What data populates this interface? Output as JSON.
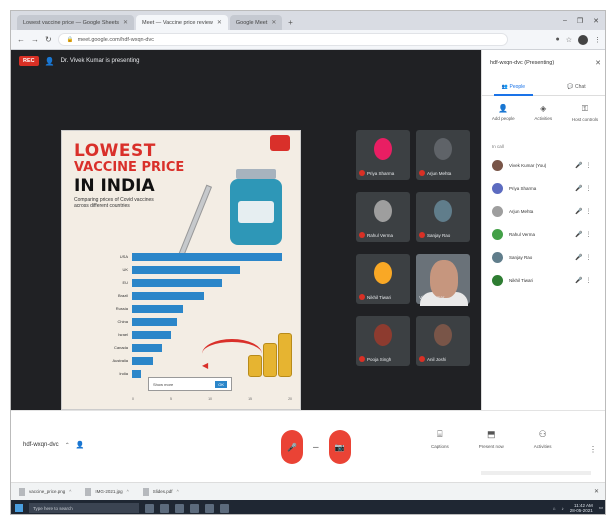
{
  "browser": {
    "tabs": [
      {
        "label": "Lowest vaccine price — Google Sheets",
        "active": false
      },
      {
        "label": "Meet — Vaccine price review",
        "active": true
      },
      {
        "label": "Google Meet",
        "active": false
      }
    ],
    "url": "meet.google.com/hdf-wxqn-dvc",
    "new_tab": "+",
    "window_controls": [
      "–",
      "❐",
      "✕"
    ]
  },
  "meet": {
    "recording_badge": "REC",
    "presenting_text": "Dr. Vivek Kumar is presenting",
    "slide": {
      "title_line1": "LOWEST",
      "title_line2": "VACCINE PRICE",
      "title_line3": "IN INDIA",
      "subtitle": "Comparing prices of Covid vaccines across different countries",
      "popup_text": "Show more",
      "popup_button": "OK"
    },
    "chart_data": {
      "type": "bar",
      "orientation": "horizontal",
      "categories": [
        "USA",
        "UK",
        "EU",
        "Brazil",
        "Russia",
        "China",
        "Israel",
        "Canada",
        "Australia",
        "India"
      ],
      "values": [
        100,
        72,
        60,
        48,
        34,
        30,
        26,
        20,
        14,
        6
      ],
      "axis_ticks": [
        "0",
        "5",
        "10",
        "15",
        "20"
      ],
      "xlim": [
        0,
        100
      ],
      "colors": {
        "bars": "#2b86c9"
      }
    },
    "participants": [
      {
        "name": "Priya Sharma",
        "avatar_color": "#e91e63",
        "muted": true,
        "video": false
      },
      {
        "name": "Arjun Mehta",
        "avatar_color": "#5f6368",
        "muted": true,
        "video": false
      },
      {
        "name": "Rahul Verma",
        "avatar_color": "#9e9e9e",
        "muted": true,
        "video": false
      },
      {
        "name": "Sanjay Rao",
        "avatar_color": "#607d8b",
        "muted": true,
        "video": false
      },
      {
        "name": "Nikhil Tiwari",
        "avatar_color": "#f9a825",
        "muted": true,
        "video": false
      },
      {
        "name": "Vivek Kumar",
        "avatar_color": "#c6967e",
        "muted": false,
        "video": true
      },
      {
        "name": "Pooja Singh",
        "avatar_color": "#8d3b2f",
        "muted": true,
        "video": false
      },
      {
        "name": "Anil Joshi",
        "avatar_color": "#795548",
        "muted": true,
        "video": false
      }
    ]
  },
  "panel": {
    "title": "hdf-wxqn-dvc (Presenting)",
    "tabs": [
      {
        "label": "People",
        "active": true
      },
      {
        "label": "Chat",
        "active": false
      }
    ],
    "actions": [
      "Add people",
      "Activities",
      "Host controls"
    ],
    "section_label": "In call",
    "people": [
      {
        "name": "Vivek Kumar (You)",
        "color": "#795548"
      },
      {
        "name": "Priya Sharma",
        "color": "#5c6bc0"
      },
      {
        "name": "Arjun Mehta",
        "color": "#9e9e9e"
      },
      {
        "name": "Rahul Verma",
        "color": "#43a047"
      },
      {
        "name": "Sanjay Rao",
        "color": "#607d8b"
      },
      {
        "name": "Nikhil Tiwari",
        "color": "#2e7d32"
      }
    ]
  },
  "bottom_bar": {
    "meeting_code": "hdf-wxqn-dvc",
    "people_icon": "people-icon",
    "right_actions": [
      "Captions",
      "Present now",
      "Activities"
    ],
    "more": "⋮"
  },
  "downloads": {
    "items": [
      {
        "name": "vaccine_price.png",
        "caret": "^"
      },
      {
        "name": "IMG-2021.jpg",
        "caret": "^"
      },
      {
        "name": "Slides.pdf",
        "caret": "^"
      }
    ],
    "close": "✕"
  },
  "taskbar": {
    "search_placeholder": "Type here to search",
    "time": "11:42 AM",
    "date": "28-05-2021"
  }
}
